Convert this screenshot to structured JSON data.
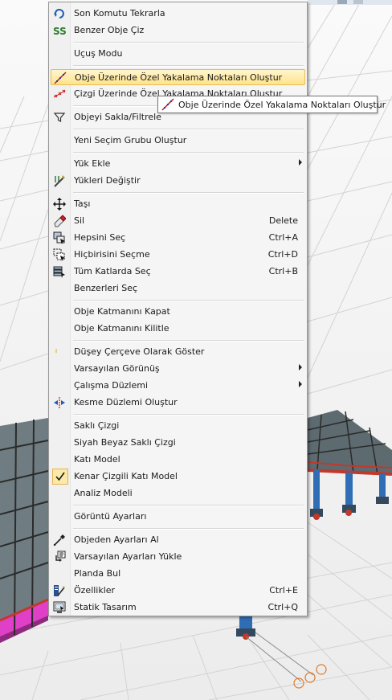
{
  "menu": {
    "items": {
      "repeat_last": {
        "label": "Son Komutu Tekrarla",
        "icon": "repeat-arrow-icon"
      },
      "draw_similar": {
        "label": "Benzer Obje Çiz",
        "icon": "double-s-icon"
      },
      "flight_mode": {
        "label": "Uçuş Modu"
      },
      "create_snap_points": {
        "label": "Obje Üzerinde Özel Yakalama Noktaları Oluştur",
        "icon": "dotted-line-red-icon"
      },
      "create_snap_points_line": {
        "label": "Çizgi Üzerinde Özel Yakalama Noktaları Oluştur",
        "icon": "dotted-line-x-icon"
      },
      "hide_filter": {
        "label": "Objeyi Sakla/Filtrele",
        "icon": "filter-funnel-icon"
      },
      "new_selection_group": {
        "label": "Yeni Seçim Grubu Oluştur"
      },
      "add_load": {
        "label": "Yük Ekle"
      },
      "change_loads": {
        "label": "Yükleri Değiştir",
        "icon": "load-edit-icon"
      },
      "move": {
        "label": "Taşı",
        "icon": "move-arrows-icon"
      },
      "delete": {
        "label": "Sil",
        "shortcut": "Delete",
        "icon": "eraser-icon"
      },
      "select_all": {
        "label": "Hepsini Seç",
        "shortcut": "Ctrl+A",
        "icon": "select-all-icon"
      },
      "select_none": {
        "label": "Hiçbirisini Seçme",
        "shortcut": "Ctrl+D",
        "icon": "select-none-icon"
      },
      "select_all_floors": {
        "label": "Tüm Katlarda Seç",
        "shortcut": "Ctrl+B",
        "icon": "select-floors-icon"
      },
      "select_similar": {
        "label": "Benzerleri Seç"
      },
      "close_layer": {
        "label": "Obje Katmanını Kapat"
      },
      "lock_layer": {
        "label": "Obje Katmanını Kilitle"
      },
      "show_vertical_frame": {
        "label": "Düşey Çerçeve Olarak Göster",
        "icon": "frame-mark-icon"
      },
      "default_views": {
        "label": "Varsayılan Görünüş"
      },
      "work_plane": {
        "label": "Çalışma Düzlemi"
      },
      "section_plane": {
        "label": "Kesme Düzlemi Oluştur",
        "icon": "section-plane-icon"
      },
      "hidden_line": {
        "label": "Saklı Çizgi"
      },
      "bw_hidden_line": {
        "label": "Siyah Beyaz Saklı Çizgi"
      },
      "solid_model": {
        "label": "Katı Model"
      },
      "edged_solid_model": {
        "label": "Kenar Çizgili Katı Model",
        "checked": true
      },
      "analysis_model": {
        "label": "Analiz Modeli"
      },
      "view_settings": {
        "label": "Görüntü Ayarları"
      },
      "settings_from_object": {
        "label": "Objeden Ayarları Al",
        "icon": "eyedropper-icon"
      },
      "load_default_settings": {
        "label": "Varsayılan Ayarları Yükle",
        "icon": "load-settings-icon"
      },
      "find_in_plan": {
        "label": "Planda Bul"
      },
      "properties": {
        "label": "Özellikler",
        "shortcut": "Ctrl+E",
        "icon": "properties-icon"
      },
      "static_design": {
        "label": "Statik Tasarım",
        "shortcut": "Ctrl+Q",
        "icon": "static-design-icon"
      }
    }
  },
  "tooltip": {
    "label": "Obje Üzerinde Özel Yakalama Noktaları Oluştur",
    "icon": "dotted-line-red-icon"
  },
  "colors": {
    "highlight": "#ffe38a",
    "steel_red": "#c0392b",
    "column_blue": "#2f6db5",
    "slab_pink": "#e040c8"
  }
}
